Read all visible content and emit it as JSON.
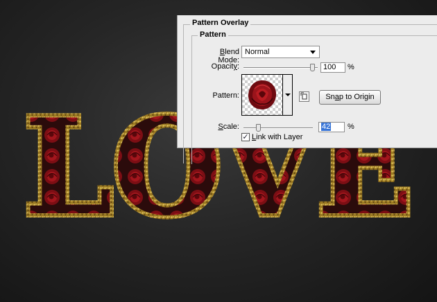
{
  "canvas": {
    "artwork_text": "LOVE"
  },
  "panel": {
    "outer_legend": "Pattern Overlay",
    "inner_legend": "Pattern",
    "blend_mode": {
      "label_underlined": "B",
      "label_rest": "lend Mode:",
      "value": "Normal"
    },
    "opacity": {
      "label_prefix": "Opacit",
      "label_underlined": "y",
      "label_suffix": ":",
      "value": "100",
      "unit": "%",
      "level_percent": 100
    },
    "pattern": {
      "label": "Pattern:",
      "swatch_name": "rose pattern",
      "new_preset_icon": "new-preset-icon",
      "snap_prefix": "Sn",
      "snap_underlined": "a",
      "snap_suffix": "p to Origin"
    },
    "scale": {
      "label_underlined": "S",
      "label_rest": "cale:",
      "value": "42",
      "unit": "%",
      "level_percent": 42
    },
    "link": {
      "checked": true,
      "check_glyph": "✓",
      "label_underlined": "L",
      "label_rest": "ink with Layer"
    }
  },
  "colors": {
    "panel_bg": "#ececec",
    "gold": "#b8942f",
    "rose": "#8e1016",
    "selection": "#3875d7"
  }
}
